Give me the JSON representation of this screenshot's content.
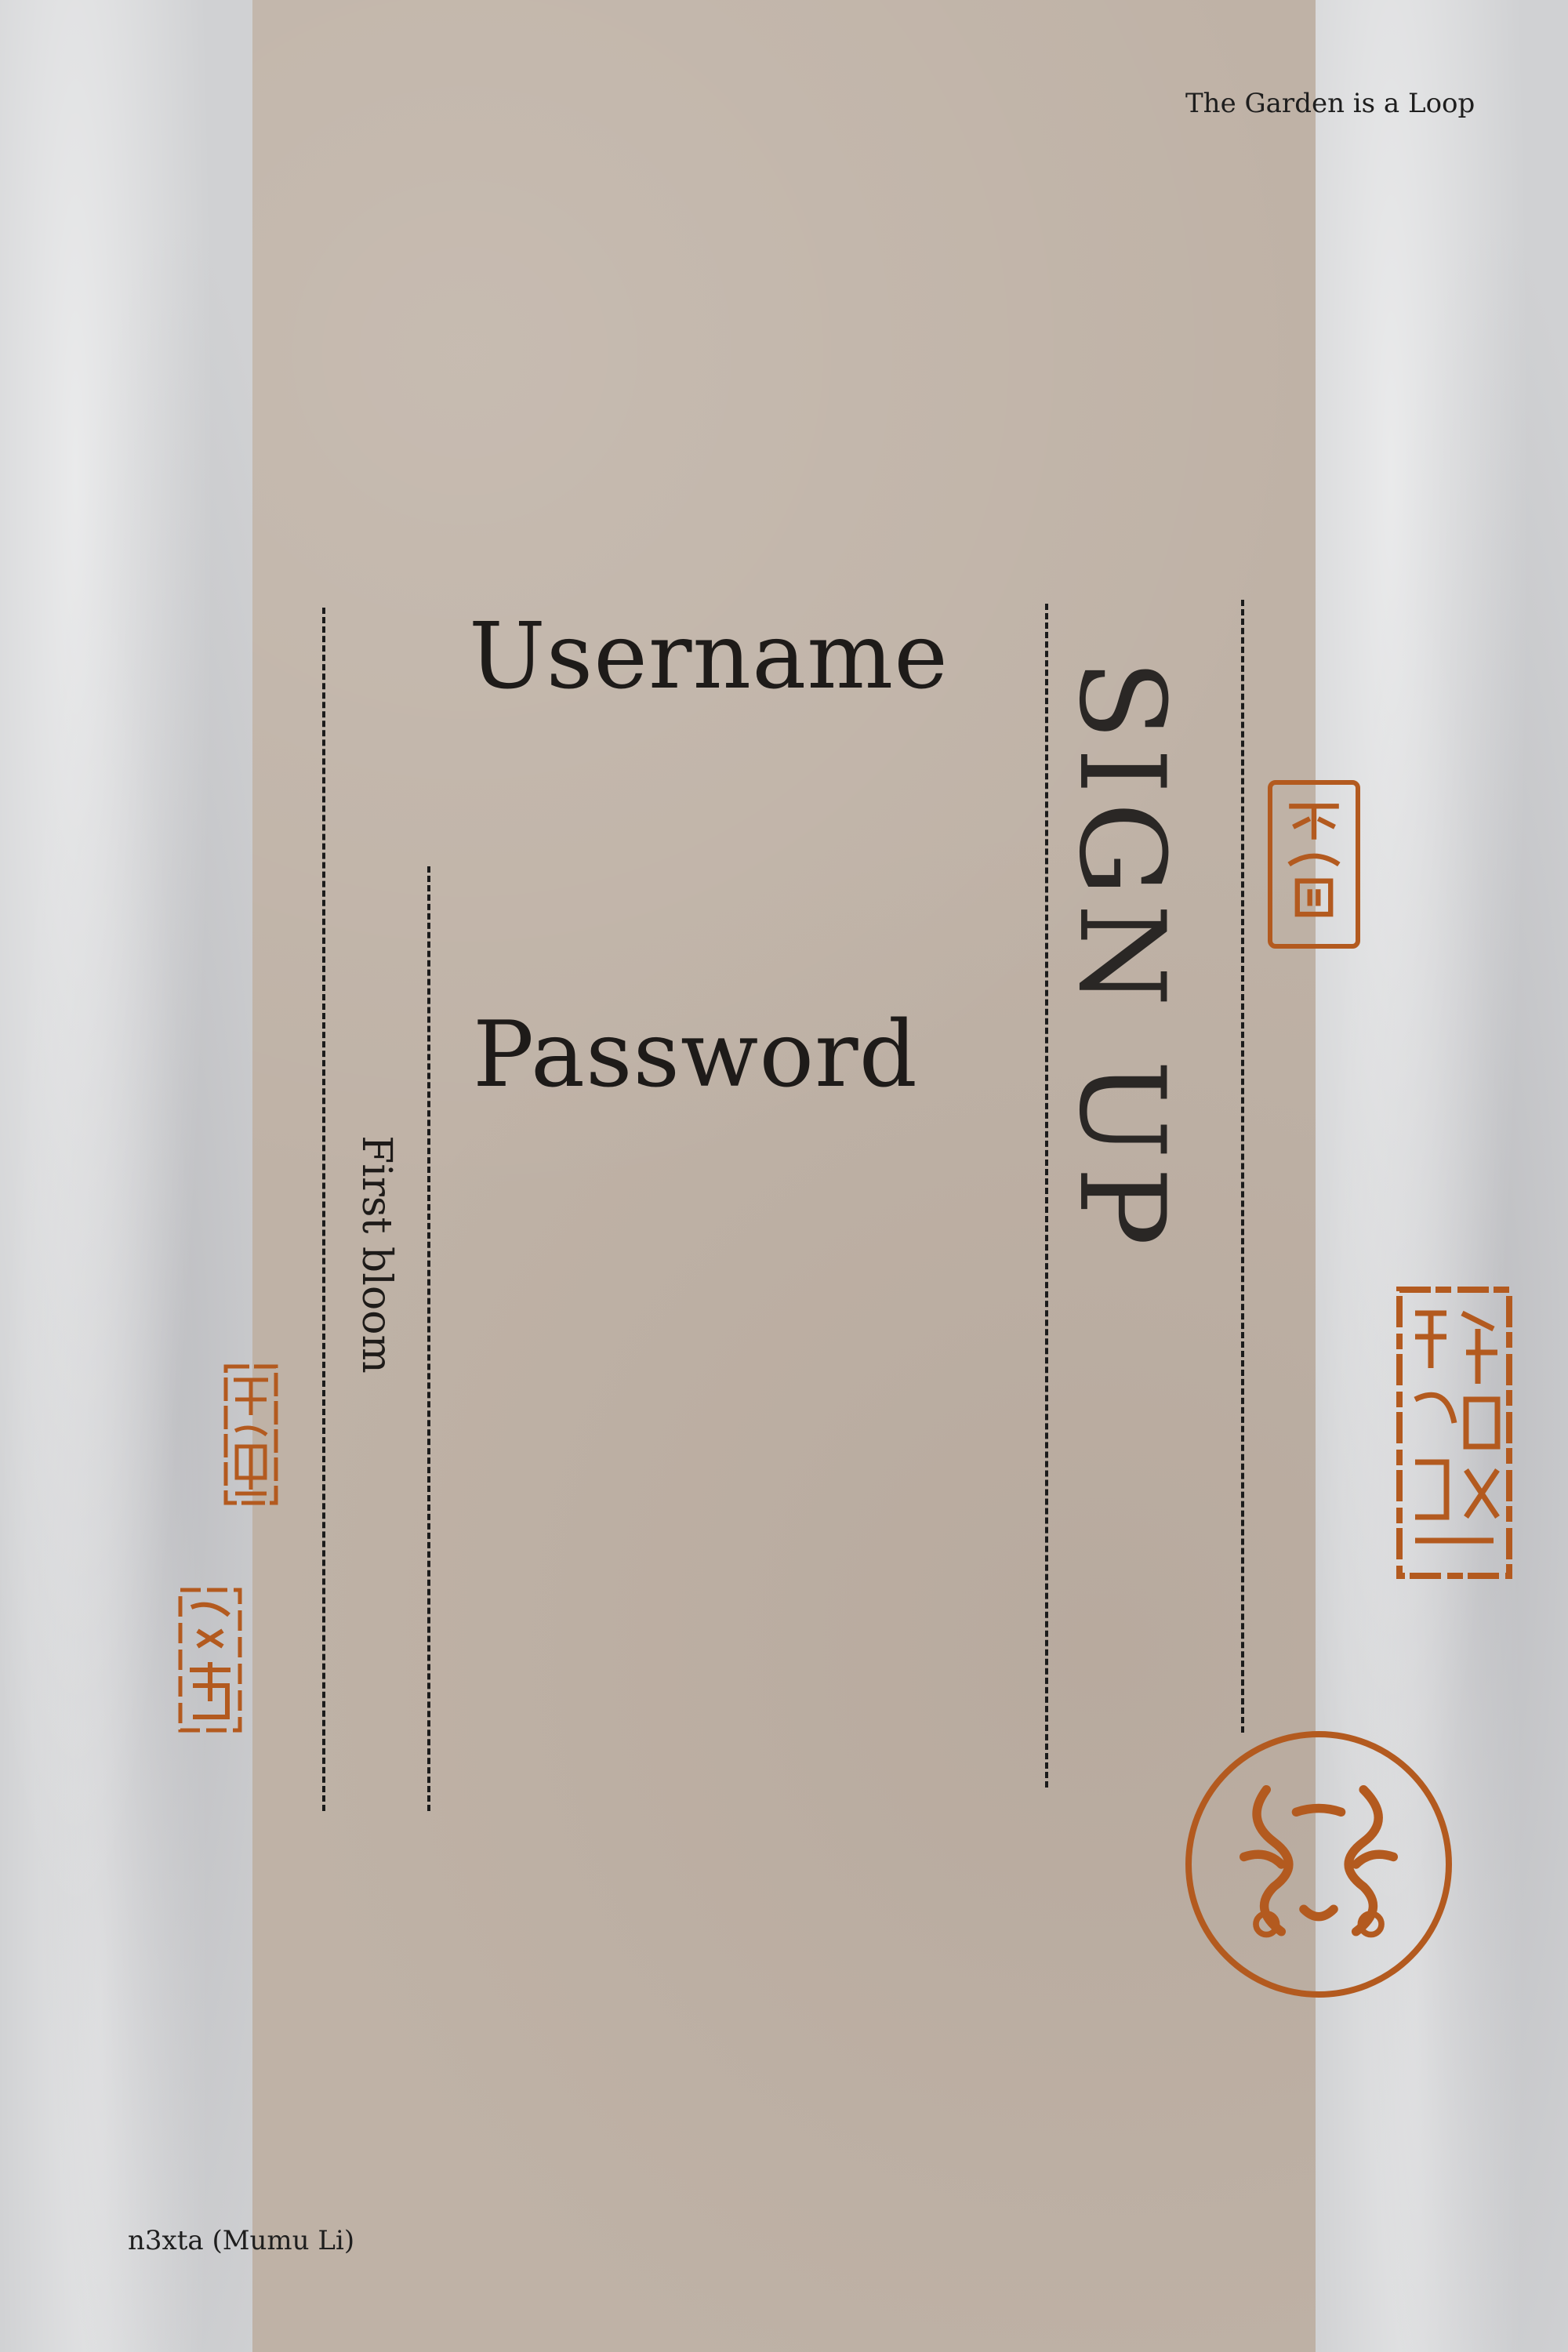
{
  "header": {
    "project_title": "The Garden is a Loop"
  },
  "form": {
    "username_label": "Username",
    "password_label": "Password",
    "signup_label": "SIGN UP",
    "caption": "First bloom"
  },
  "footer": {
    "credit": "n3xta (Mumu Li)"
  },
  "colors": {
    "paper": "#bfb2a6",
    "side": "#d0d1d3",
    "ink": "#1e1b19",
    "seal": "#b35a1f"
  }
}
